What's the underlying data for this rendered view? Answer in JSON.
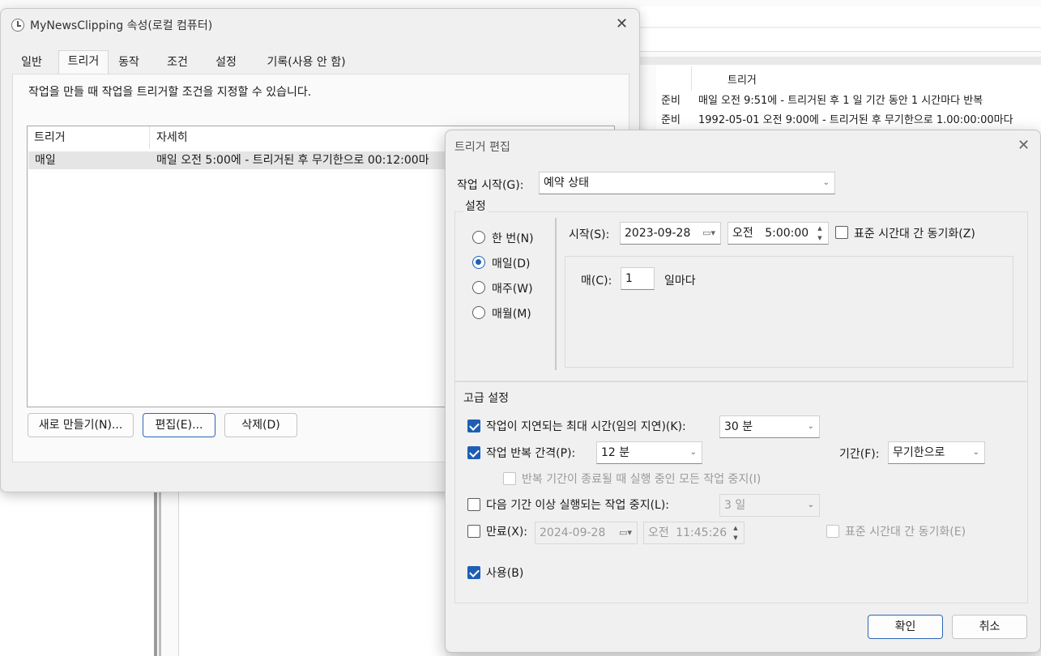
{
  "background": {
    "column_header": "트리거",
    "rows": [
      {
        "status": "준비",
        "trigger": "매일 오전 9:51에 - 트리거된 후 1 일 기간 동안 1 시간마다 반복"
      },
      {
        "status": "준비",
        "trigger": "1992-05-01 오전 9:00에 - 트리거된 후 무기한으로 1.00:00:00마다"
      }
    ]
  },
  "props": {
    "title": "MyNewsClipping 속성(로컬 컴퓨터)",
    "tabs": [
      "일반",
      "트리거",
      "동작",
      "조건",
      "설정",
      "기록(사용 안 함)"
    ],
    "active_tab": "트리거",
    "description": "작업을 만들 때 작업을 트리거할 조건을 지정할 수 있습니다.",
    "table": {
      "headers": [
        "트리거",
        "자세히"
      ],
      "rows": [
        {
          "trigger": "매일",
          "detail": "매일 오전 5:00에 - 트리거된 후 무기한으로 00:12:00마"
        }
      ]
    },
    "buttons": {
      "new": "새로 만들기(N)...",
      "edit": "편집(E)...",
      "delete": "삭제(D)"
    }
  },
  "edit": {
    "title": "트리거 편집",
    "begin_label": "작업 시작(G):",
    "begin_value": "예약 상태",
    "settings_label": "설정",
    "schedule_options": [
      "한 번(N)",
      "매일(D)",
      "매주(W)",
      "매월(M)"
    ],
    "selected_schedule": "매일(D)",
    "start_label": "시작(S):",
    "start_date": "2023-09-28",
    "start_ampm": "오전",
    "start_time": "5:00:00",
    "sync_tz_label": "표준 시간대 간 동기화(Z)",
    "every_label": "매(C):",
    "every_value": "1",
    "every_unit": "일마다",
    "advanced_label": "고급 설정",
    "delay_label": "작업이 지연되는 최대 시간(임의 지연)(K):",
    "delay_value": "30 분",
    "delay_checked": true,
    "repeat_label": "작업 반복 간격(P):",
    "repeat_value": "12 분",
    "repeat_checked": true,
    "duration_label": "기간(F):",
    "duration_value": "무기한으로",
    "stop_all_label": "반복 기간이 종료될 때 실행 중인 모든 작업 중지(I)",
    "stop_longer_label": "다음 기간 이상 실행되는 작업 중지(L):",
    "stop_longer_value": "3 일",
    "expire_label": "만료(X):",
    "expire_date": "2024-09-28",
    "expire_ampm": "오전",
    "expire_time": "11:45:26",
    "expire_sync_label": "표준 시간대 간 동기화(E)",
    "enabled_label": "사용(B)",
    "ok": "확인",
    "cancel": "취소"
  }
}
